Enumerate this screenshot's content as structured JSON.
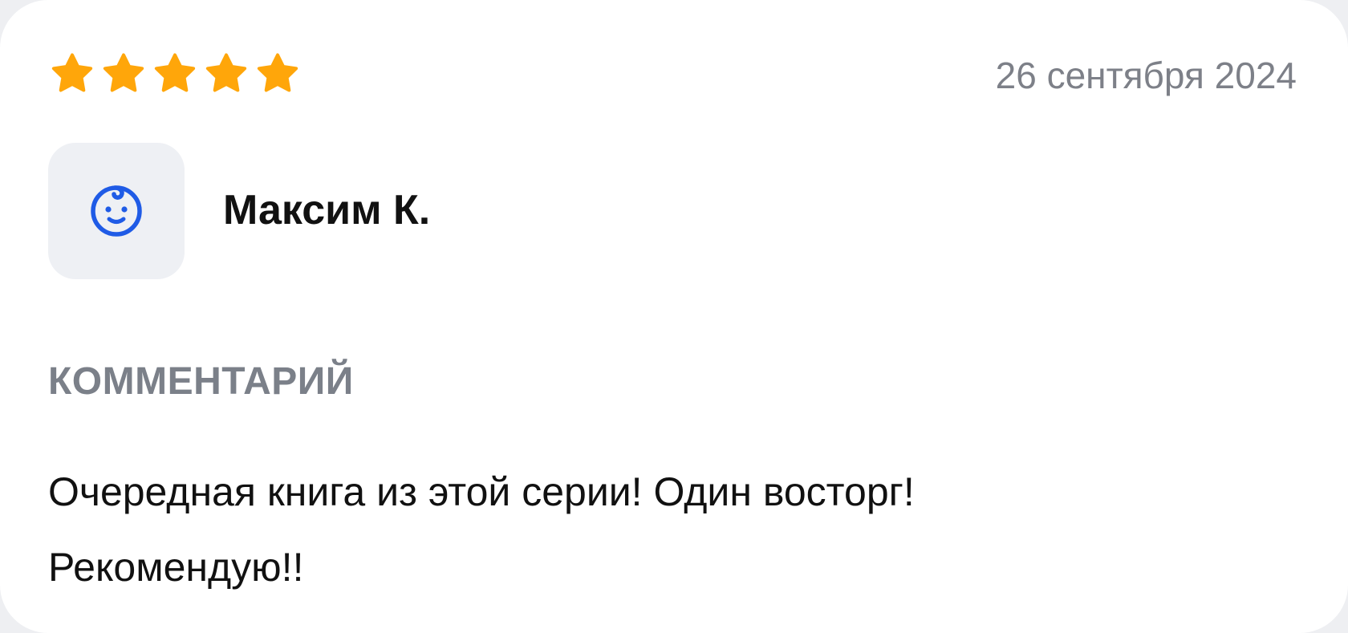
{
  "review": {
    "rating": 5,
    "rating_max": 5,
    "star_color": "#FFA60A",
    "date": "26 сентября 2024",
    "author": {
      "name": "Максим К.",
      "avatar_icon": "baby-face-icon",
      "avatar_icon_color": "#1F5BE6"
    },
    "comment_label": "КОММЕНТАРИЙ",
    "comment_lines": [
      "Очередная книга из этой серии! Один восторг!",
      "Рекомендую!!"
    ]
  }
}
